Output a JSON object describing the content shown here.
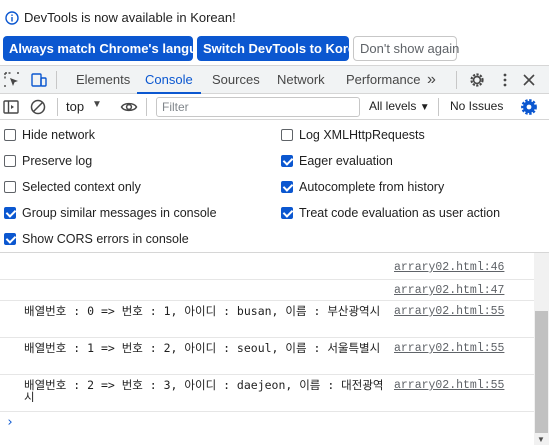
{
  "banner": {
    "message": "DevTools is now available in Korean!",
    "buttons": [
      {
        "label": "Always match Chrome's language"
      },
      {
        "label": "Switch DevTools to Korean"
      },
      {
        "label": "Don't show again"
      }
    ]
  },
  "tabs": [
    {
      "label": "Elements"
    },
    {
      "label": "Console"
    },
    {
      "label": "Sources"
    },
    {
      "label": "Network"
    },
    {
      "label": "Performance"
    }
  ],
  "more_tabs": "»",
  "toolbar": {
    "context": "top",
    "filter_placeholder": "Filter",
    "levels": "All levels",
    "issues": "No Issues"
  },
  "settings": {
    "left": [
      {
        "label": "Hide network",
        "checked": false
      },
      {
        "label": "Preserve log",
        "checked": false
      },
      {
        "label": "Selected context only",
        "checked": false
      },
      {
        "label": "Group similar messages in console",
        "checked": true
      },
      {
        "label": "Show CORS errors in console",
        "checked": true
      }
    ],
    "right": [
      {
        "label": "Log XMLHttpRequests",
        "checked": false
      },
      {
        "label": "Eager evaluation",
        "checked": true
      },
      {
        "label": "Autocomplete from history",
        "checked": true
      },
      {
        "label": "Treat code evaluation as user action",
        "checked": true
      }
    ]
  },
  "console": {
    "messages": [
      {
        "text": "",
        "source": "arrary02.html:46"
      },
      {
        "text": "",
        "source": "arrary02.html:47"
      },
      {
        "text": "배열번호 : 0 => 번호 : 1, 아이디 : busan, 이름 : 부산광역시",
        "source": "arrary02.html:55"
      },
      {
        "text": "배열번호 : 1 => 번호 : 2, 아이디 : seoul, 이름 : 서울특별시",
        "source": "arrary02.html:55"
      },
      {
        "text": "배열번호 : 2 => 번호 : 3, 아이디 : daejeon, 이름 : 대전광역시",
        "source": "arrary02.html:55"
      }
    ],
    "prompt": "›"
  }
}
